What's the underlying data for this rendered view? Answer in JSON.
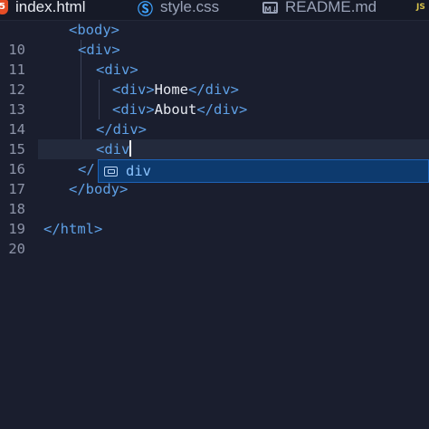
{
  "tabs": [
    {
      "label": "index.html",
      "icon": "html5-icon",
      "active": true
    },
    {
      "label": "style.css",
      "icon": "css3-icon",
      "active": false
    },
    {
      "label": "README.md",
      "icon": "markdown-icon",
      "active": false
    },
    {
      "label": "JS",
      "icon": "javascript-icon",
      "active": false
    }
  ],
  "icons": {
    "html": "5",
    "css": "3",
    "md": "M↓",
    "js": "JS"
  },
  "lines": [
    {
      "num": "10",
      "pre": "<",
      "name": "body",
      "post": ">"
    },
    {
      "num": "11",
      "pre": "<",
      "name": "div",
      "post": ">"
    },
    {
      "num": "12",
      "pre": "<",
      "name": "div",
      "post": ">"
    },
    {
      "num": "13",
      "open": "<div>",
      "text": "Home",
      "close": "</div>"
    },
    {
      "num": "14",
      "open": "<div>",
      "text": "About",
      "close": "</div>"
    },
    {
      "num": "15",
      "pre": "</",
      "name": "div",
      "post": ">"
    },
    {
      "num": "16",
      "typed": "<div"
    },
    {
      "num": "17",
      "partial": "</"
    },
    {
      "num": "18",
      "pre": "</",
      "name": "body",
      "post": ">"
    },
    {
      "num": "19"
    },
    {
      "num": "20",
      "pre": "</",
      "name": "html",
      "post": ">"
    }
  ],
  "autocomplete": {
    "icon": "snippet-icon",
    "suggestion": "div"
  },
  "colors": {
    "background": "#1a1e2e",
    "tag": "#5ea0e6",
    "text": "#e6e9f0",
    "suggestion_bg": "#0d3a6e"
  }
}
